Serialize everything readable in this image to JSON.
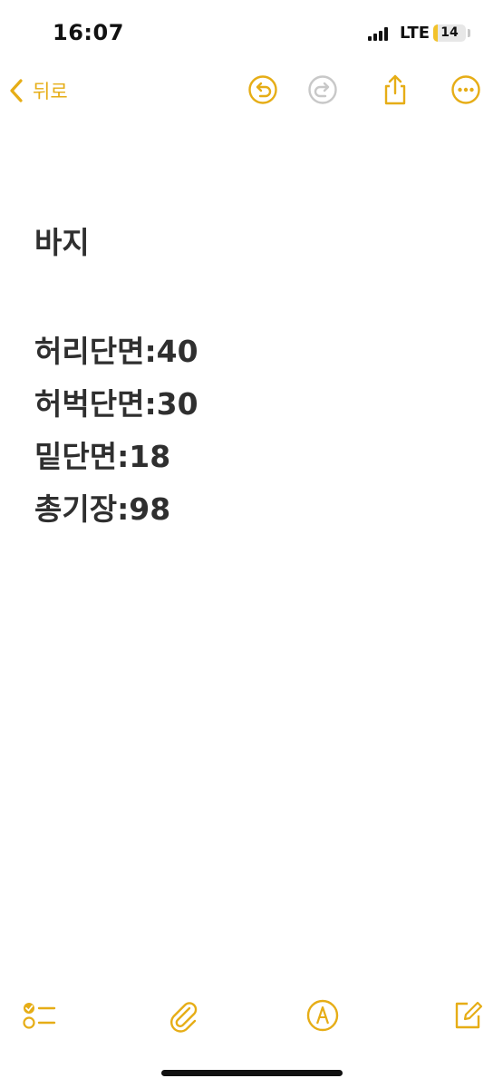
{
  "status_bar": {
    "time": "16:07",
    "network": "LTE",
    "battery_level": "14",
    "battery_fraction": 0.14
  },
  "nav": {
    "back_label": "뒤로",
    "icons": [
      "undo-icon",
      "redo-icon",
      "share-icon",
      "more-icon"
    ]
  },
  "note": {
    "title": "바지",
    "lines": [
      "허리단면:40",
      "허벅단면:30",
      "밑단면:18",
      "총기장:98"
    ]
  },
  "toolbar": {
    "icons": [
      "checklist-icon",
      "paperclip-icon",
      "markup-pen-icon",
      "compose-icon"
    ]
  },
  "colors": {
    "accent": "#e6ad16",
    "text": "#2f2f2f",
    "disabled": "#c8c8c8",
    "background": "#ffffff"
  }
}
